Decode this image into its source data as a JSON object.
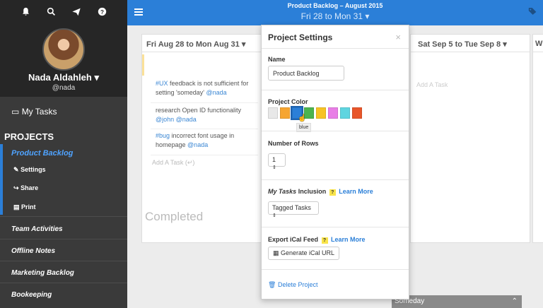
{
  "header": {
    "title": "Product Backlog – August 2015",
    "date_range": "Fri 28 to Mon 31",
    "menu_icon": "hamburger-icon",
    "tag_icon": "tags-icon"
  },
  "sidebar": {
    "icons": [
      "bell-icon",
      "search-icon",
      "send-icon",
      "help-icon"
    ],
    "user_name": "Nada Aldahleh",
    "user_handle": "@nada",
    "my_tasks": "My Tasks",
    "projects_heading": "PROJECTS",
    "active_project": "Product Backlog",
    "sub_items": [
      "Settings",
      "Share",
      "Print"
    ],
    "projects": [
      "Team Activities",
      "Offline Notes",
      "Marketing Backlog",
      "Bookeeping"
    ]
  },
  "board": {
    "col1_header": "Fri Aug 28 to Mon Aug 31",
    "tasks": [
      {
        "tag": "#UX",
        "text": " feedback is not sufficient for setting 'someday' ",
        "mention": "@nada"
      },
      {
        "tag": "",
        "text": "research Open ID functionality ",
        "mention": "@john @nada"
      },
      {
        "tag": "#bug",
        "text": " incorrect font usage in homepage ",
        "mention": "@nada"
      }
    ],
    "add_task": "Add A Task (↵)",
    "completed": "Completed",
    "col2_header": "Sat Sep 5 to Tue Sep 8",
    "col2_add_task": "Add A Task",
    "col3_header": "W",
    "someday": "Someday"
  },
  "modal": {
    "title": "Project Settings",
    "close": "×",
    "name_label": "Name",
    "name_value": "Product Backlog",
    "color_label": "Project Color",
    "colors": [
      "#e8e8e8",
      "#f6a531",
      "#2b7fd8",
      "#4cb44f",
      "#f7c325",
      "#e87ee6",
      "#5fd5e0",
      "#e8562a"
    ],
    "selected_color_tooltip": "blue",
    "rows_label": "Number of Rows",
    "rows_value": "1",
    "inclusion_label_em": "My Tasks",
    "inclusion_label_rest": " Inclusion",
    "learn_more": "Learn More",
    "inclusion_value": "Tagged Tasks",
    "export_label": "Export iCal Feed",
    "generate_button": "Generate iCal URL",
    "delete_label": "Delete Project"
  }
}
